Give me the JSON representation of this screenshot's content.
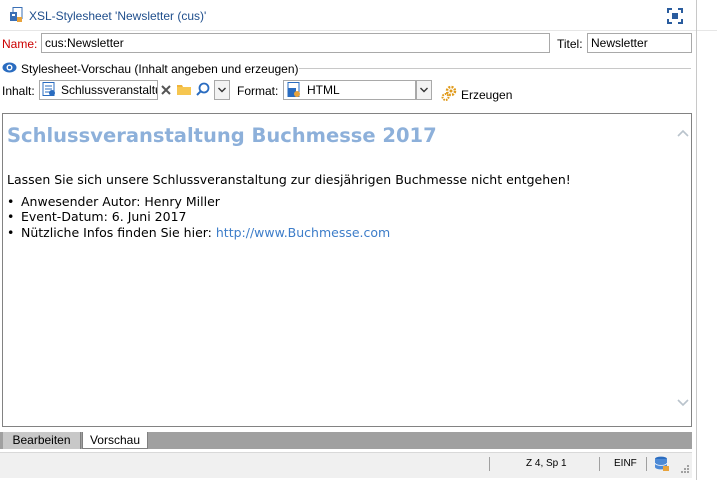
{
  "window": {
    "title": "XSL-Stylesheet 'Newsletter (cus)'"
  },
  "form": {
    "name_label": "Name:",
    "name_value": "cus:Newsletter",
    "title_label": "Titel:",
    "title_value": "Newsletter"
  },
  "preview_group": {
    "label": "Stylesheet-Vorschau (Inhalt angeben und erzeugen)",
    "content_label": "Inhalt:",
    "content_value": "Schlussveranstaltu",
    "format_label": "Format:",
    "format_value": "HTML",
    "generate_label": "Erzeugen"
  },
  "preview": {
    "title": "Schlussveranstaltung Buchmesse 2017",
    "intro": "Lassen Sie sich unsere Schlussveranstaltung zur diesjährigen Buchmesse nicht entgehen!",
    "items": [
      {
        "bullet": "•",
        "text": "Anwesender Autor: Henry Miller"
      },
      {
        "bullet": "•",
        "text": "Event-Datum: 6. Juni 2017"
      },
      {
        "bullet": "•",
        "text": "Nützliche Infos finden Sie hier: ",
        "link": "http://www.Buchmesse.com"
      }
    ]
  },
  "tabs": [
    {
      "label": "Bearbeiten"
    },
    {
      "label": "Vorschau"
    }
  ],
  "status": {
    "position": "Z 4, Sp 1",
    "mode": "EINF"
  },
  "colors": {
    "name_label": "#cc0000",
    "title_bar_text": "#1f4e8c",
    "preview_title": "#8db0da",
    "link": "#3d7dc9"
  },
  "icons": [
    "stylesheet-icon",
    "maximize-icon",
    "eye-icon",
    "document-icon",
    "clear-icon",
    "folder-icon",
    "search-icon",
    "chevron-down-icon",
    "gear-icon",
    "scroll-up-icon",
    "scroll-down-icon",
    "database-icon"
  ]
}
